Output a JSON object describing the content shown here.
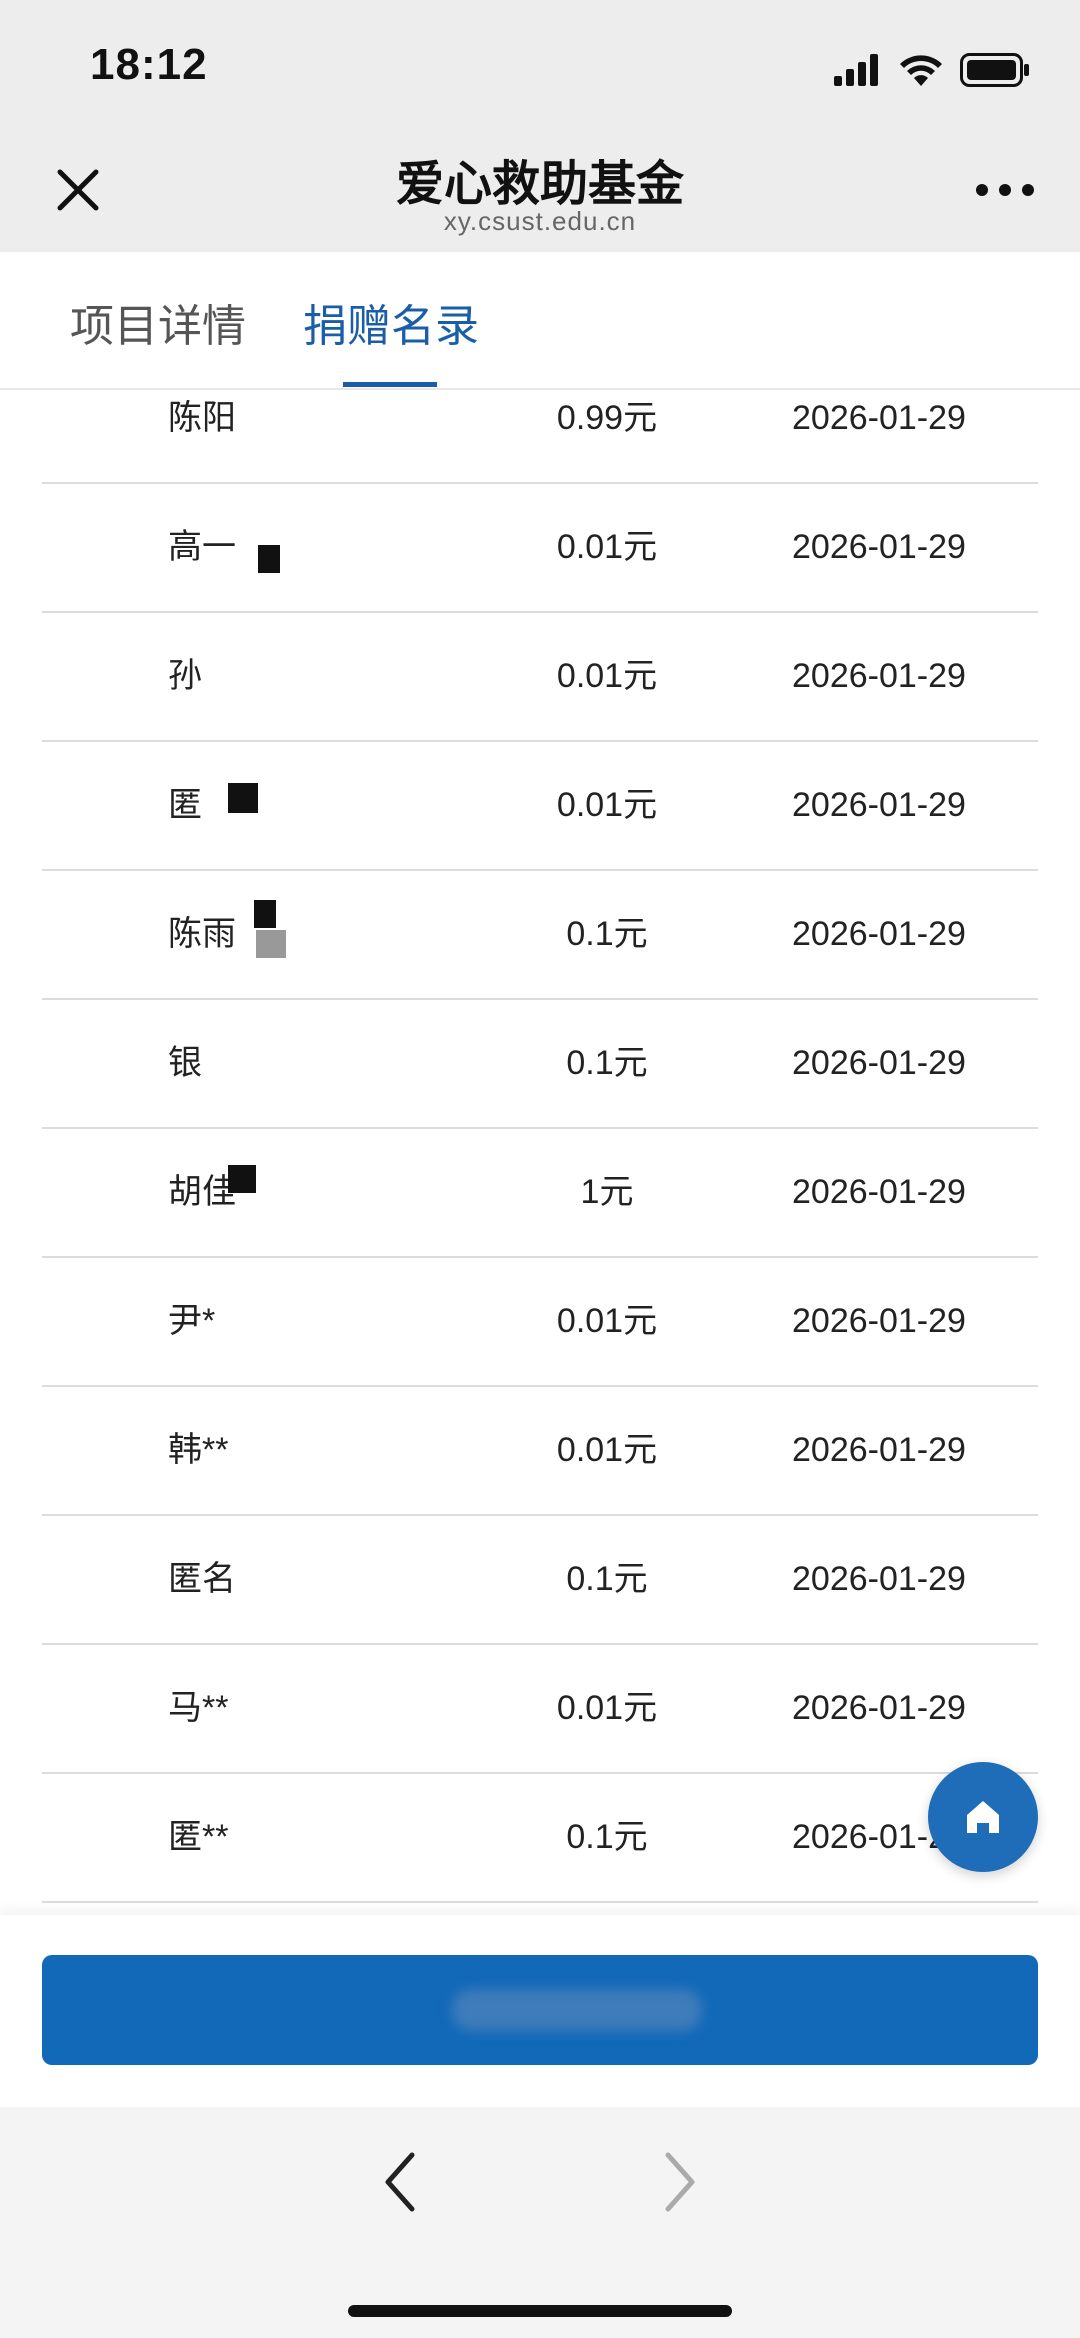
{
  "status_bar": {
    "time": "18:12"
  },
  "header": {
    "title": "爱心救助基金",
    "url": "xy.csust.edu.cn"
  },
  "tabs": [
    {
      "label": "项目详情",
      "active": false
    },
    {
      "label": "捐赠名录",
      "active": true
    }
  ],
  "donations": [
    {
      "name": "陈阳",
      "amount": "0.99元",
      "date": "2026-01-29"
    },
    {
      "name": "高一",
      "amount": "0.01元",
      "date": "2026-01-29"
    },
    {
      "name": "孙",
      "amount": "0.01元",
      "date": "2026-01-29"
    },
    {
      "name": "匿",
      "amount": "0.01元",
      "date": "2026-01-29"
    },
    {
      "name": "陈雨",
      "amount": "0.1元",
      "date": "2026-01-29"
    },
    {
      "name": "银",
      "amount": "0.1元",
      "date": "2026-01-29"
    },
    {
      "name": "胡佳",
      "amount": "1元",
      "date": "2026-01-29"
    },
    {
      "name": "尹*",
      "amount": "0.01元",
      "date": "2026-01-29"
    },
    {
      "name": "韩**",
      "amount": "0.01元",
      "date": "2026-01-29"
    },
    {
      "name": "匿名",
      "amount": "0.1元",
      "date": "2026-01-29"
    },
    {
      "name": "马**",
      "amount": "0.01元",
      "date": "2026-01-29"
    },
    {
      "name": "匿**",
      "amount": "0.1元",
      "date": "2026-01-29"
    }
  ],
  "colors": {
    "accent": "#1a5ea8",
    "button": "#1169b8",
    "fab": "#1f6db8"
  },
  "icons": [
    "close-icon",
    "more-icon",
    "home-icon",
    "back-icon",
    "forward-icon",
    "signal-icon",
    "wifi-icon",
    "battery-icon"
  ]
}
